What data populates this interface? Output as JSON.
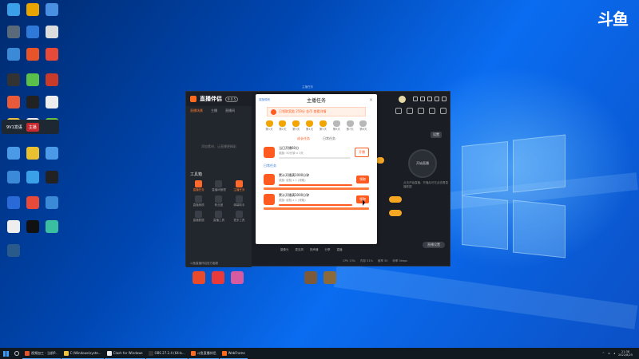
{
  "watermark": "斗鱼",
  "desktop_icons": [
    {
      "label": "",
      "color": "#3ba0e8"
    },
    {
      "label": "",
      "color": "#e8a400"
    },
    {
      "label": "",
      "color": "#4a90e2"
    },
    {
      "label": "",
      "color": "#5a6a7a"
    },
    {
      "label": "",
      "color": "#2f7ad8"
    },
    {
      "label": "",
      "color": "#dddddd"
    },
    {
      "label": "",
      "color": "#3a8ad8"
    },
    {
      "label": "",
      "color": "#e8542a"
    },
    {
      "label": "",
      "color": "#e84a3a"
    },
    {
      "label": "",
      "color": "#333333"
    },
    {
      "label": "",
      "color": "#5ac04a"
    },
    {
      "label": "",
      "color": "#c83a2a"
    },
    {
      "label": "",
      "color": "#e85a3a"
    },
    {
      "label": "",
      "color": "#222222"
    },
    {
      "label": "",
      "color": "#eeeeee"
    },
    {
      "label": "",
      "color": "#e8c040"
    },
    {
      "label": "",
      "color": "#eeeeee"
    },
    {
      "label": "",
      "color": "#6ac040"
    },
    {
      "label": "",
      "color": "#4a9ae8"
    },
    {
      "label": "",
      "color": "#e8c030"
    },
    {
      "label": "",
      "color": "#4a9ae8"
    },
    {
      "label": "",
      "color": "#3a8ad8"
    },
    {
      "label": "",
      "color": "#3aa0e8"
    },
    {
      "label": "",
      "color": "#222222"
    },
    {
      "label": "",
      "color": "#2a6ad8"
    },
    {
      "label": "",
      "color": "#e84a3a"
    },
    {
      "label": "",
      "color": "#3a8ad8"
    },
    {
      "label": "",
      "color": "#eeeeee"
    },
    {
      "label": "",
      "color": "#111111"
    },
    {
      "label": "",
      "color": "#3ac0a0"
    },
    {
      "label": "",
      "color": "#2a5a8a"
    }
  ],
  "bottom_desktop_icons": [
    {
      "label": "",
      "color": "#e84a2a"
    },
    {
      "label": "",
      "color": "#e83a3a"
    },
    {
      "label": "",
      "color": "#d85aa0"
    },
    {
      "label": "",
      "color": "#7a5a3a"
    },
    {
      "label": "",
      "color": "#8a6a3a"
    }
  ],
  "tooltip": {
    "left": "9V1发语",
    "right": "主播"
  },
  "app": {
    "logo": "直播伴侣",
    "version": "9.0.5",
    "tabs": [
      "直播场景",
      "主播",
      "直播间"
    ],
    "empty_hint": "添加素材，让直播更精彩",
    "tools_title": "工具箱",
    "tools": [
      {
        "label": "直播任务",
        "on": true
      },
      {
        "label": "直播间管理",
        "on": false
      },
      {
        "label": "主播任务",
        "on": true
      },
      {
        "label": "直播美颜",
        "on": false
      },
      {
        "label": "粉丝团",
        "on": false
      },
      {
        "label": "弹幕助手",
        "on": false
      },
      {
        "label": "直播数据",
        "on": false
      },
      {
        "label": "直播工具",
        "on": false
      },
      {
        "label": "更多工具",
        "on": false
      }
    ],
    "footer": "斗鱼直播伴侣官方客服",
    "preview_button": "直播设置",
    "right_top_button": "设置",
    "circle_label": "开始直播",
    "circle_caption": "点击开始直播，开播后可在此查看直播数据",
    "bottom_tools": [
      "摄像头",
      "麦克风",
      "扬声器",
      "分享",
      "直播"
    ],
    "bottom_stats": [
      "CPU 13%",
      "内存 51%",
      "帧率 30",
      "码率 0kbps"
    ]
  },
  "modal": {
    "window_caption": "主播任务",
    "title": "主播任务",
    "rules": "奖励规则",
    "close": "×",
    "banner": "已领取奖励 259分 金币 查看详情",
    "levels": [
      {
        "label": "第1天",
        "on": true
      },
      {
        "label": "第2天",
        "on": true
      },
      {
        "label": "第3天",
        "on": true
      },
      {
        "label": "第4天",
        "on": true
      },
      {
        "label": "第5天",
        "on": true
      },
      {
        "label": "第6天",
        "on": false
      },
      {
        "label": "第7天",
        "on": false
      },
      {
        "label": "第8天",
        "on": false
      }
    ],
    "segments": [
      "成长任务",
      "日常任务"
    ],
    "tasks_main": [
      {
        "name": "当日开播60分",
        "desc": "奖励: 50分钟 x 1天",
        "button": "开播",
        "progress": 0.0,
        "style": "outline",
        "fullbar": false
      }
    ],
    "section_daily": "日常任务",
    "tasks_daily": [
      {
        "name": "累计开播满1000分钟",
        "desc": "奖励: 经验 x 1 (领取)",
        "button": "领取",
        "progress": 1.0,
        "style": "solid",
        "fullbar": true
      },
      {
        "name": "累计开播满3000分钟",
        "desc": "奖励: 经验 x 1 (领取)",
        "button": "领取",
        "progress": 1.0,
        "style": "solid",
        "fullbar": true
      }
    ]
  },
  "taskbar": {
    "items": [
      {
        "label": "视频加工 - 当前P...",
        "color": "#e8542a"
      },
      {
        "label": "C:\\Windows\\syste...",
        "color": "#f0c040"
      },
      {
        "label": "Clash for Windows",
        "color": "#eeeeee"
      },
      {
        "label": "OBS 27.2.4 (64-b...",
        "color": "#333333"
      },
      {
        "label": "斗鱼直播伴侣",
        "color": "#ff6a1f"
      },
      {
        "label": "WebFrame",
        "color": "#ff6a1f"
      }
    ],
    "time": "21:38",
    "date": "2022/8/25"
  }
}
